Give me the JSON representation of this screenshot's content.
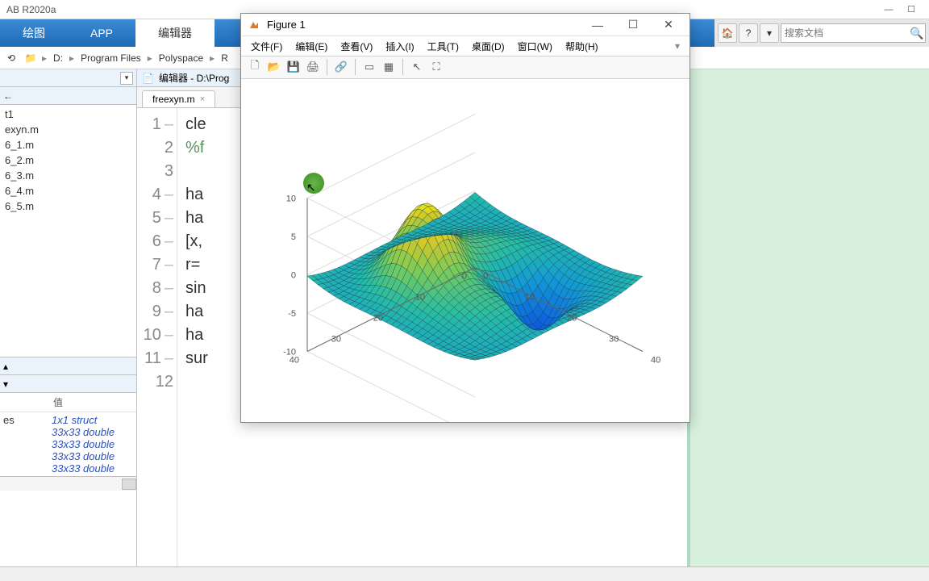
{
  "app": {
    "title": "AB R2020a"
  },
  "winbuttons": {
    "min": "—",
    "max": "☐"
  },
  "toolstrip": {
    "tab_plot": "绘图",
    "tab_app": "APP",
    "tab_editor": "编辑器"
  },
  "search": {
    "placeholder": "搜索文档"
  },
  "path": {
    "drive": "D:",
    "p1": "Program Files",
    "p2": "Polyspace",
    "p3": "R"
  },
  "files_header": "t1",
  "files": [
    "exyn.m",
    "6_1.m",
    "6_2.m",
    "6_3.m",
    "6_4.m",
    "6_5.m"
  ],
  "workspace": {
    "col_value": "值",
    "col_name": "es",
    "rows": [
      {
        "val": "1x1 struct"
      },
      {
        "val": "33x33 double"
      },
      {
        "val": "33x33 double"
      },
      {
        "val": "33x33 double"
      },
      {
        "val": "33x33 double"
      }
    ]
  },
  "editor": {
    "title_prefix": "编辑器 - D:\\Prog",
    "tab_name": "freexyn.m",
    "lines": [
      "cle",
      "%f",
      "",
      "ha",
      "ha",
      "[x,",
      "r=",
      "sin",
      "ha",
      "ha",
      "sur",
      ""
    ]
  },
  "figure": {
    "title": "Figure 1",
    "menus": {
      "file": "文件(F)",
      "edit": "编辑(E)",
      "view": "查看(V)",
      "insert": "插入(I)",
      "tools": "工具(T)",
      "desktop": "桌面(D)",
      "window": "窗口(W)",
      "help": "帮助(H)"
    },
    "winbtn": {
      "min": "—",
      "max": "☐",
      "close": "✕"
    }
  },
  "chart_data": {
    "type": "surface3d",
    "description": "sinc-like 3D surface (peaks) on a 33x33 grid",
    "x_range": [
      0,
      40
    ],
    "y_range": [
      0,
      40
    ],
    "z_range": [
      -10,
      10
    ],
    "x_ticks": [
      0,
      10,
      20,
      30,
      40
    ],
    "y_ticks": [
      0,
      10,
      20,
      30,
      40
    ],
    "z_ticks": [
      -10,
      -5,
      0,
      5,
      10
    ],
    "grid_size": [
      33,
      33
    ],
    "z_peak_approx": 8,
    "z_trough_approx": -8,
    "colormap": "parula"
  }
}
